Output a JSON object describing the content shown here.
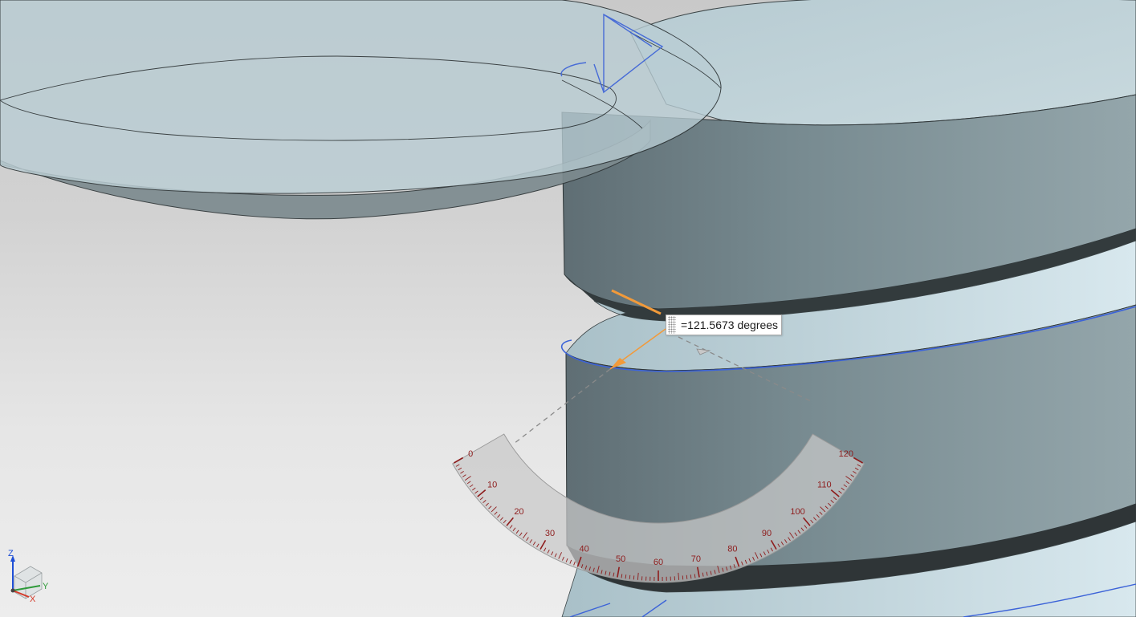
{
  "measurement": {
    "readout": "=121.5673 degrees",
    "angle_degrees": 121.5673
  },
  "protractor": {
    "range_min": 0,
    "range_max": 120,
    "labels": [
      "0",
      "10",
      "20",
      "30",
      "40",
      "50",
      "60",
      "70",
      "80",
      "90",
      "100",
      "110",
      "120"
    ]
  },
  "triad": {
    "z_label": "Z",
    "y_label": "Y",
    "x_label": "X"
  },
  "colors": {
    "background_top": "#c9c9c9",
    "background_bottom": "#ededed",
    "part_face": "#b9cdd4",
    "part_side": "#6d7d83",
    "highlight_edge": "#3c63d8",
    "measure_leg": "#f29a3a",
    "protractor_ticks": "#8e1c1c",
    "protractor_band": "#c9c9c9"
  }
}
